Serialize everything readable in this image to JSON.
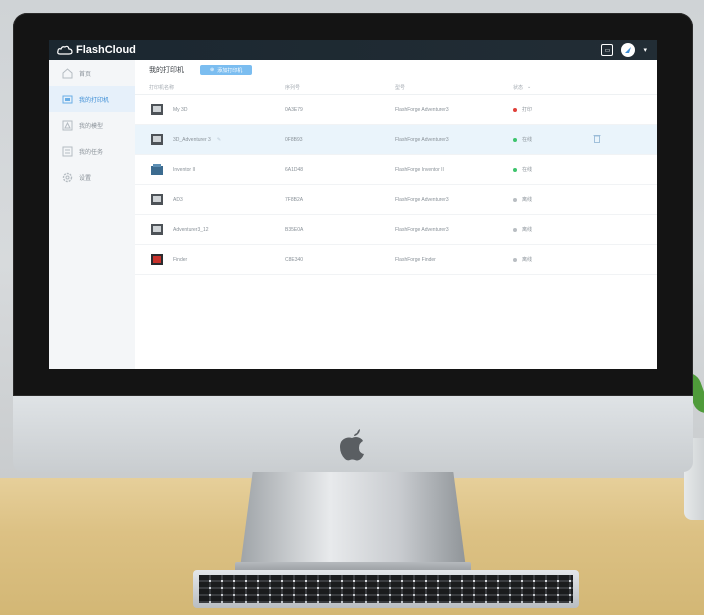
{
  "app": {
    "brand": "FlashCloud"
  },
  "header": {
    "icons": [
      "screen-toggle-icon",
      "user-avatar-icon",
      "chevron-down-icon"
    ],
    "caret": "▾"
  },
  "sidebar": {
    "items": [
      {
        "label": "首页",
        "icon": "home-icon",
        "active": false
      },
      {
        "label": "我的打印机",
        "icon": "printer-icon",
        "active": true
      },
      {
        "label": "我的模型",
        "icon": "model-icon",
        "active": false
      },
      {
        "label": "我的任务",
        "icon": "task-icon",
        "active": false
      },
      {
        "label": "设置",
        "icon": "gear-icon",
        "active": false
      }
    ]
  },
  "main": {
    "title": "我的打印机",
    "add_button": "添加打印机",
    "columns": [
      "打印机名称",
      "序列号",
      "型号",
      "状态"
    ],
    "rows": [
      {
        "name": "My 3D",
        "serial": "0A3E79",
        "model": "FlashForge Adventurer3",
        "status": "打印",
        "status_color": "#e0403a"
      },
      {
        "name": "3D_Adventurer 3",
        "serial": "0F8B93",
        "model": "FlashForge Adventurer3",
        "status": "在线",
        "status_color": "#3ec46d"
      },
      {
        "name": "Inventor II",
        "serial": "6A1D48",
        "model": "FlashForge Inventor II",
        "status": "在线",
        "status_color": "#3ec46d"
      },
      {
        "name": "AD3",
        "serial": "7F8B2A",
        "model": "FlashForge Adventurer3",
        "status": "离线",
        "status_color": "#b9bec3"
      },
      {
        "name": "Adventurer3_12",
        "serial": "B35E0A",
        "model": "FlashForge Adventurer3",
        "status": "离线",
        "status_color": "#b9bec3"
      },
      {
        "name": "Finder",
        "serial": "C8E340",
        "model": "FlashForge Finder",
        "status": "离线",
        "status_color": "#b9bec3"
      }
    ]
  },
  "colors": {
    "accent": "#7bbdf0",
    "topbar": "#1b2730"
  }
}
